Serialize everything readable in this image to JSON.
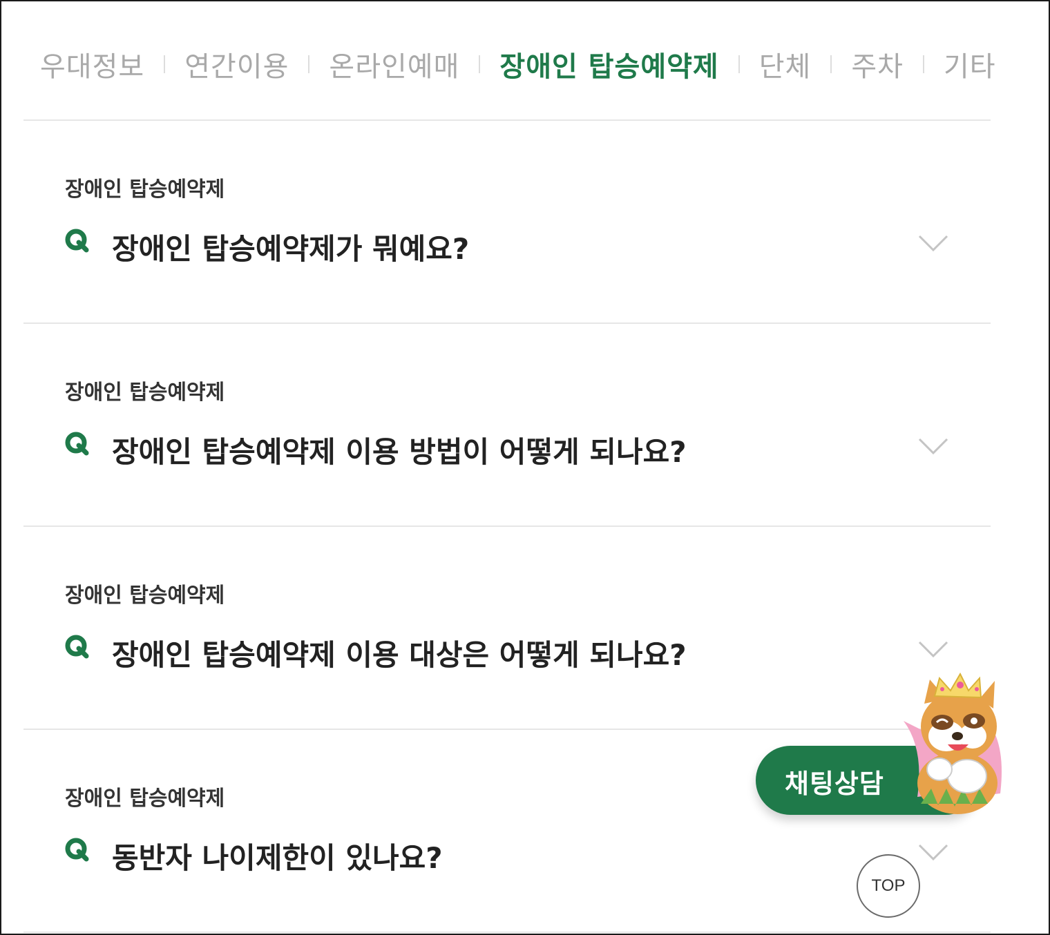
{
  "tabs": [
    {
      "label": "우대정보",
      "active": false
    },
    {
      "label": "연간이용",
      "active": false
    },
    {
      "label": "온라인예매",
      "active": false
    },
    {
      "label": "장애인 탑승예약제",
      "active": true
    },
    {
      "label": "단체",
      "active": false
    },
    {
      "label": "주차",
      "active": false
    },
    {
      "label": "기타",
      "active": false
    }
  ],
  "faq": [
    {
      "category": "장애인 탑승예약제",
      "question": "장애인 탑승예약제가 뭐예요?"
    },
    {
      "category": "장애인 탑승예약제",
      "question": "장애인 탑승예약제 이용 방법이 어떻게 되나요?"
    },
    {
      "category": "장애인 탑승예약제",
      "question": "장애인 탑승예약제 이용 대상은 어떻게 되나요?"
    },
    {
      "category": "장애인 탑승예약제",
      "question": "동반자 나이제한이 있나요?"
    }
  ],
  "chat": {
    "label": "채팅상담"
  },
  "top_button": {
    "label": "TOP"
  },
  "icons": {
    "question": "q-icon",
    "expand": "chevron-down-icon",
    "mascot": "mascot-raccoon-icon"
  },
  "colors": {
    "accent": "#1f7a4a",
    "tab_inactive": "#a9a9a9",
    "divider": "#e6e6e6",
    "text": "#222222"
  }
}
